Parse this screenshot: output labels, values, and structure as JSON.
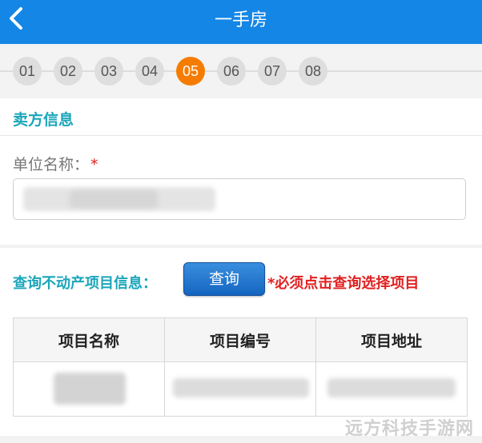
{
  "header": {
    "title": "一手房",
    "back_icon": "chevron-left-icon",
    "bg_color": "#1486e6"
  },
  "steps": {
    "items": [
      "01",
      "02",
      "03",
      "04",
      "05",
      "06",
      "07",
      "08"
    ],
    "active": "05",
    "active_color": "#f57c00"
  },
  "seller": {
    "section_title": "卖方信息",
    "unit_label": "单位名称：",
    "required_mark": "*",
    "unit_value": ""
  },
  "query": {
    "label": "查询不动产项目信息：",
    "button_label": "查询",
    "note": "*必须点击查询选择项目"
  },
  "table": {
    "headers": [
      "项目名称",
      "项目编号",
      "项目地址"
    ],
    "rows": [
      [
        "",
        "",
        ""
      ]
    ]
  },
  "watermark": "远方科技手游网",
  "colors": {
    "accent": "#1aa6bb",
    "required": "#e02020"
  }
}
